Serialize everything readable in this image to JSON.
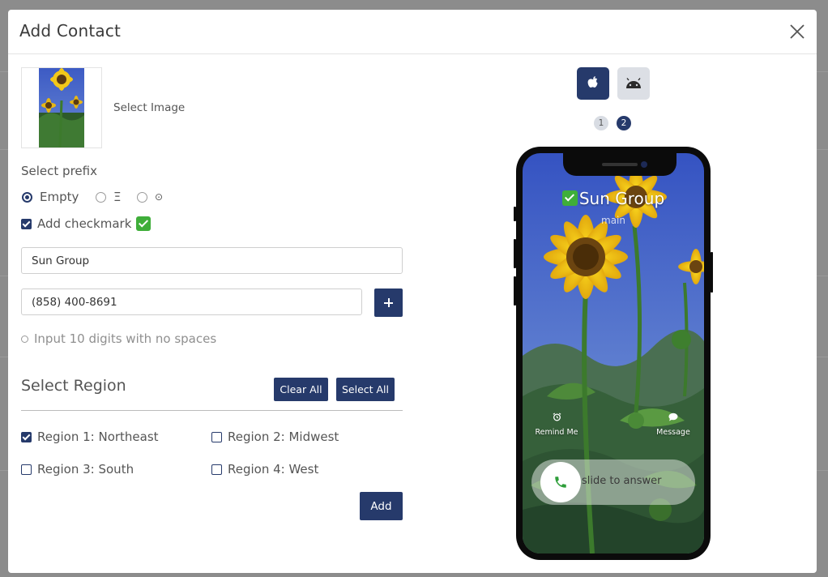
{
  "modal": {
    "title": "Add Contact"
  },
  "image_picker": {
    "select_label": "Select Image"
  },
  "prefix": {
    "label": "Select prefix",
    "options": [
      {
        "label": "Empty",
        "selected": true
      },
      {
        "label": "Ξ",
        "selected": false
      },
      {
        "label": "⊙",
        "selected": false
      }
    ]
  },
  "checkmark": {
    "label": "Add checkmark",
    "checked": true
  },
  "form": {
    "name_value": "Sun Group",
    "phone_value": "(858) 400-8691",
    "hint": "Input 10 digits with no spaces"
  },
  "regions": {
    "title": "Select Region",
    "clear_all": "Clear All",
    "select_all": "Select All",
    "items": [
      {
        "label": "Region 1: Northeast",
        "checked": true
      },
      {
        "label": "Region 2: Midwest",
        "checked": false
      },
      {
        "label": "Region 3: South",
        "checked": false
      },
      {
        "label": "Region 4: West",
        "checked": false
      }
    ]
  },
  "add_button": "Add",
  "preview": {
    "os_options": [
      "apple",
      "android"
    ],
    "active_os": "apple",
    "steps": [
      "1",
      "2"
    ],
    "active_step": "2",
    "caller_name": "Sun Group",
    "caller_sub": "main",
    "remind_label": "Remind Me",
    "message_label": "Message",
    "slide_label": "slide to answer"
  },
  "colors": {
    "accent": "#263a6b",
    "check_green": "#3fae3a"
  }
}
